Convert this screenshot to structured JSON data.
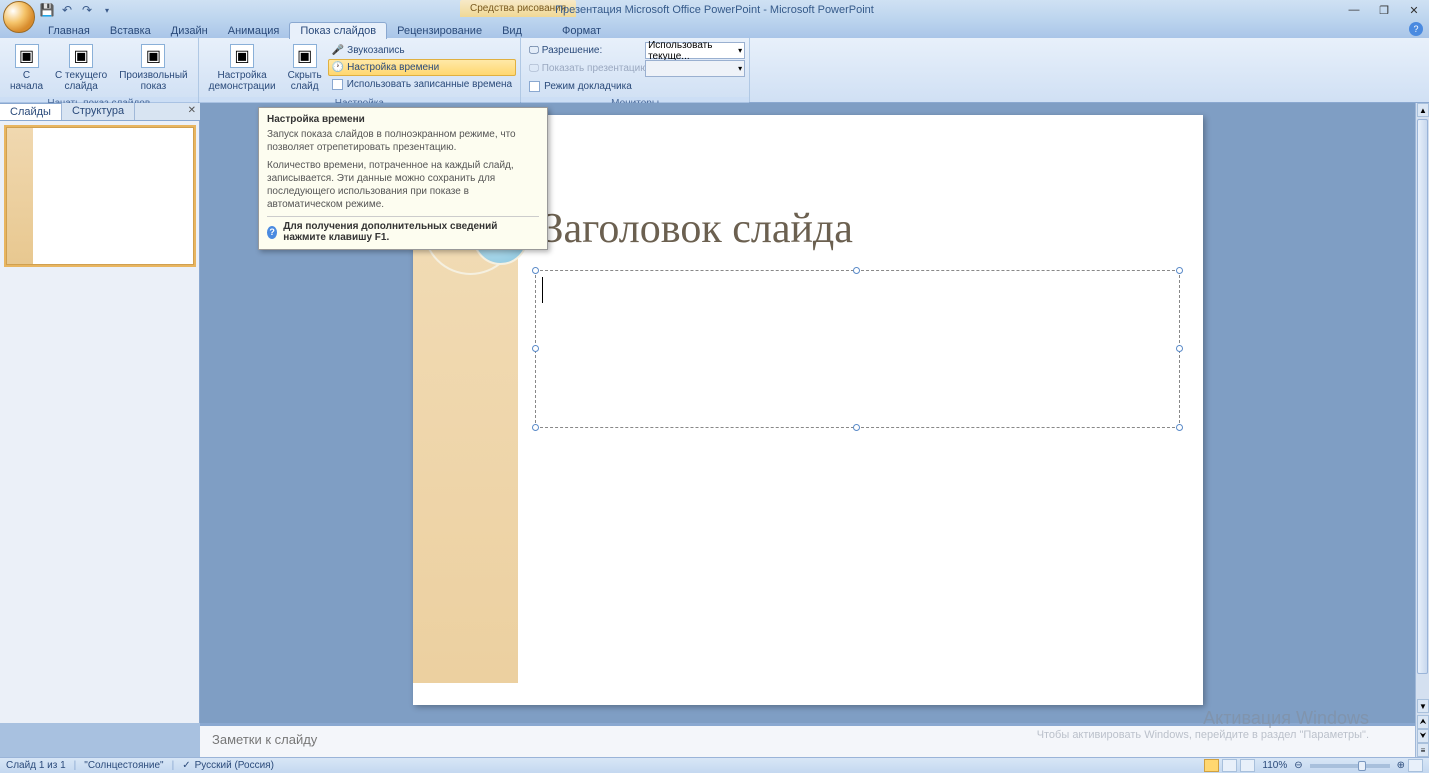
{
  "title_bar": {
    "contextual_tab": "Средства рисования",
    "app_title": "Презентация Microsoft Office PowerPoint - Microsoft PowerPoint"
  },
  "tabs": {
    "home": "Главная",
    "insert": "Вставка",
    "design": "Дизайн",
    "animations": "Анимация",
    "slideshow": "Показ слайдов",
    "review": "Рецензирование",
    "view": "Вид",
    "format": "Формат"
  },
  "ribbon": {
    "group1": {
      "from_beginning": "С\nначала",
      "from_current": "С текущего\nслайда",
      "custom": "Произвольный\nпоказ",
      "label": "Начать показ слайдов"
    },
    "group2": {
      "setup": "Настройка\nдемонстрации",
      "hide": "Скрыть\nслайд",
      "record": "Звукозапись",
      "rehearse": "Настройка времени",
      "use_timings": "Использовать записанные времена",
      "label": "Настройка"
    },
    "group3": {
      "resolution_label": "Разрешение:",
      "resolution_value": "Использовать текуще...",
      "show_on": "Показать презентацию на:",
      "presenter_view": "Режим докладчика",
      "label": "Мониторы"
    }
  },
  "panel": {
    "tab_slides": "Слайды",
    "tab_outline": "Структура"
  },
  "slide": {
    "title": "Заголовок слайда"
  },
  "tooltip": {
    "title": "Настройка времени",
    "p1": "Запуск показа слайдов в полноэкранном режиме, что позволяет отрепетировать презентацию.",
    "p2": "Количество времени, потраченное на каждый слайд, записывается. Эти данные можно сохранить для последующего использования при показе в автоматическом режиме.",
    "f1": "Для получения дополнительных сведений нажмите клавишу F1."
  },
  "notes": {
    "placeholder": "Заметки к слайду"
  },
  "status": {
    "slide_info": "Слайд 1 из 1",
    "theme": "\"Солнцестояние\"",
    "language": "Русский (Россия)",
    "zoom": "110%"
  },
  "watermark": {
    "title": "Активация Windows",
    "sub": "Чтобы активировать Windows, перейдите в раздел \"Параметры\"."
  }
}
